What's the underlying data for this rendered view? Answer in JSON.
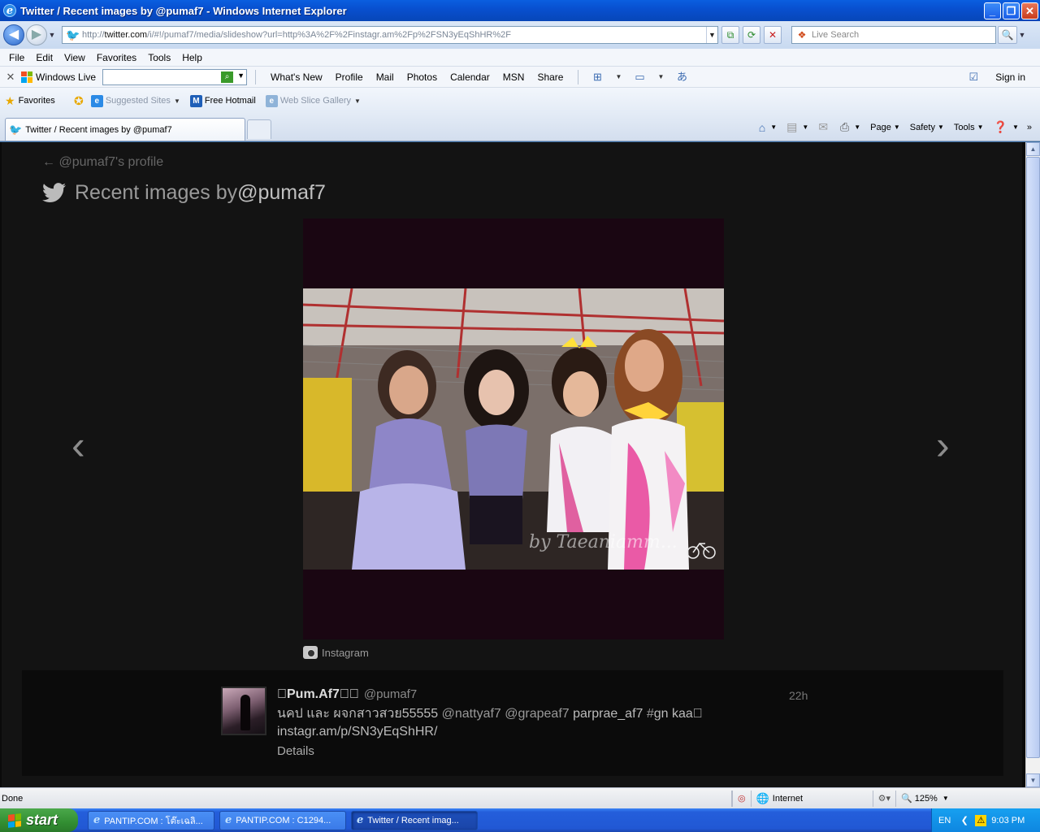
{
  "window": {
    "title": "Twitter / Recent images by @pumaf7 - Windows Internet Explorer",
    "minimize": "_",
    "maximize": "❐",
    "close": "✕"
  },
  "address": {
    "url_prefix": "http://",
    "url_host": "twitter.com",
    "url_rest": "/i/#!/pumaf7/media/slideshow?url=http%3A%2F%2Finstagr.am%2Fp%2FSN3yEqShHR%2F",
    "search_placeholder": "Live Search"
  },
  "menu": [
    "File",
    "Edit",
    "View",
    "Favorites",
    "Tools",
    "Help"
  ],
  "livebar": {
    "brand": "Windows Live",
    "links": [
      "What's New",
      "Profile",
      "Mail",
      "Photos",
      "Calendar",
      "MSN",
      "Share"
    ],
    "signin": "Sign in"
  },
  "favorites": {
    "label": "Favorites",
    "suggested": "Suggested Sites",
    "hotmail": "Free Hotmail",
    "webslice": "Web Slice Gallery"
  },
  "tab": {
    "title": "Twitter / Recent images by @pumaf7"
  },
  "commands": {
    "page": "Page",
    "safety": "Safety",
    "tools": "Tools"
  },
  "page": {
    "back_link": "← @pumaf7's profile",
    "heading_prefix": "Recent images by ",
    "heading_handle": "@pumaf7",
    "watermark": "by Taeaniamm...",
    "prev": "‹",
    "next": "›",
    "source": "Instagram"
  },
  "tweet": {
    "name": "\u0000Pum.Af7\u0000\u0000",
    "handle": "@pumaf7",
    "time": "22h",
    "text_part1": "นคป และ ผจกสาวสวย55555 ",
    "mention1": "@nattyaf7",
    "mention2": "@grapeaf7",
    "text_part2": " parprae_af7 ",
    "hashtag": "#",
    "text_part3": "gn kaa\u0000",
    "link": "instagr.am/p/SN3yEqShHR/",
    "details": "Details"
  },
  "status": {
    "text": "Done",
    "zone": "Internet",
    "zoom": "125%"
  },
  "taskbar": {
    "start": "start",
    "items": [
      "PANTIP.COM : โต๊ะเฉลิ...",
      "PANTIP.COM : C1294...",
      "Twitter / Recent imag..."
    ],
    "lang": "EN",
    "clock": "9:03 PM"
  },
  "colors": {
    "titlebar": "#0850d0",
    "page_bg": "#131313",
    "twitter_blue": "#2aa9e0",
    "start_green": "#328e32"
  }
}
